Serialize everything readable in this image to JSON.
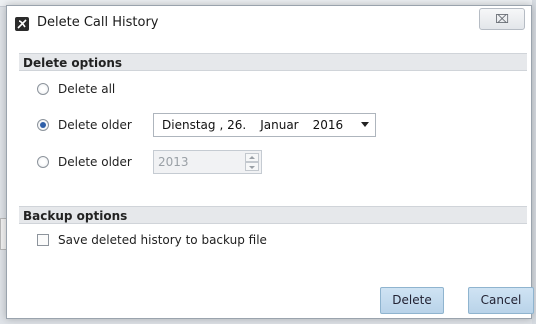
{
  "dialog": {
    "title": "Delete Call History",
    "close_symbol": "⌧"
  },
  "delete_options": {
    "header": "Delete options",
    "option_all": "Delete all",
    "option_older_date": "Delete older",
    "option_older_year": "Delete older",
    "selected": "option_older_date",
    "date": {
      "weekday": "Dienstag",
      "day": ", 26.",
      "month": "Januar",
      "year": "2016"
    },
    "year_value": "2013"
  },
  "backup_options": {
    "header": "Backup options",
    "save_label": "Save deleted history to backup file",
    "checked": false
  },
  "buttons": {
    "delete_label": "Delete",
    "cancel_label": "Cancel"
  },
  "colors": {
    "accent": "#2f5fa8",
    "button_face": "#c4dbee"
  }
}
